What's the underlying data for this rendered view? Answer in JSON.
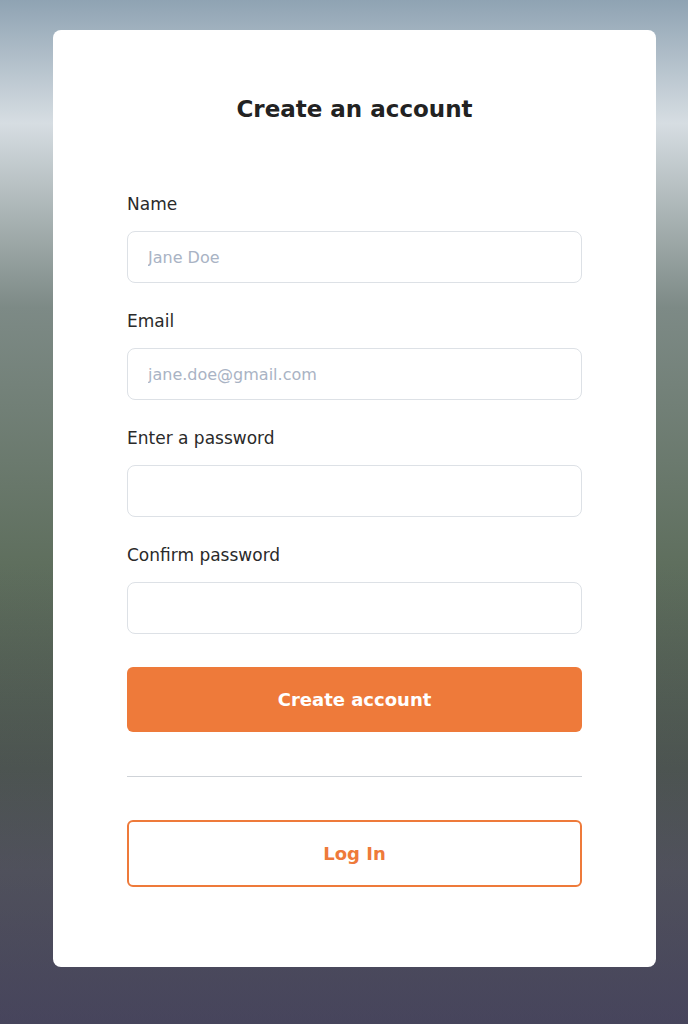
{
  "title": "Create an account",
  "fields": [
    {
      "label": "Name",
      "placeholder": "Jane Doe",
      "kind": "text"
    },
    {
      "label": "Email",
      "placeholder": "jane.doe@gmail.com",
      "kind": "email"
    },
    {
      "label": "Enter a password",
      "placeholder": "",
      "kind": "password"
    },
    {
      "label": "Confirm password",
      "placeholder": "",
      "kind": "password"
    }
  ],
  "primary_button": "Create account",
  "secondary_button": "Log In"
}
